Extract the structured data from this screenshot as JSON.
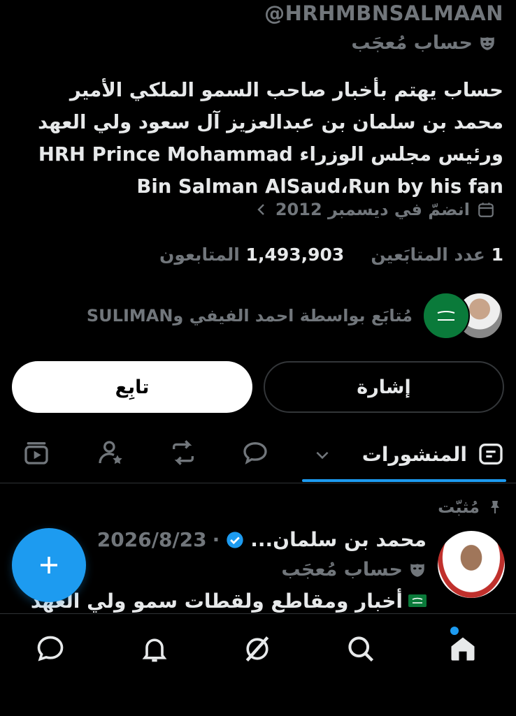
{
  "profile": {
    "handle": "@HRHMBNSALMAAN",
    "badge_label": "حساب مُعجَب",
    "bio": "حساب يهتم بأخبار صاحب السمو الملكي الأمير محمد بن سلمان بن عبدالعزيز آل سعود ولي العهد ورئيس مجلس الوزراء HRH Prince Mohammad Bin Salman AlSaud،Run by his fan",
    "joined": "انضمّ في ديسمبر 2012",
    "following_count": "1",
    "following_label": "عدد المتابَعين",
    "followers_count": "1,493,903",
    "followers_label": "المتابعون",
    "followed_by": "مُتابَع بواسطة احمد الفيفي وSULIMAN"
  },
  "actions": {
    "follow_label": "تابِع",
    "mention_label": "إشارة"
  },
  "tabs": {
    "active_label": "المنشورات",
    "icons": [
      "posts-icon",
      "chevron-down-icon",
      "replies-icon",
      "reposts-icon",
      "follow-person-icon",
      "media-icon"
    ]
  },
  "post": {
    "pinned_label": "مُثبّت",
    "author": "محمد بن سلمان...",
    "date": "2026/8/23",
    "badge_label": "حساب مُعجَب",
    "text": "أخبار ومقاطع ولقطات سمو ولي العهد",
    "flag_icon": "saudi-flag-icon"
  },
  "nav": {
    "icons": [
      "home-icon",
      "search-icon",
      "grok-icon",
      "notifications-icon",
      "messages-icon"
    ]
  },
  "colors": {
    "background": "#000000",
    "accent": "#1d9bf0",
    "text": "#e7e9ea",
    "muted": "#71767b"
  }
}
